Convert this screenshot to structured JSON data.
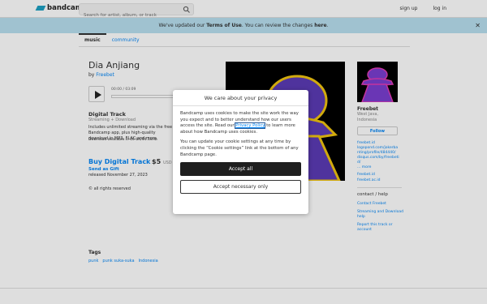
{
  "header": {
    "logo_text": "bandcamp",
    "search_placeholder": "Search for artist, album, or track",
    "signup": "sign up",
    "login": "log in"
  },
  "banner": {
    "prefix": "We've updated our ",
    "terms": "Terms of Use",
    "middle": ". You can review the changes ",
    "here": "here",
    "suffix": "."
  },
  "tabs": [
    "music",
    "community"
  ],
  "album": {
    "title": "Dia Anjiang",
    "by": "by",
    "artist": "Freebet",
    "time": "00:00 / 03:09",
    "digital_track": "Digital Track",
    "streaming": "Streaming + Download",
    "description": "Includes unlimited streaming via the free Bandcamp app, plus high-quality download in MP3, FLAC and more.",
    "format": "Download available in 16-bit/44.1kHz.",
    "buy": "Buy Digital Track",
    "price": "$5",
    "currency": "USD",
    "gift": "Send as Gift",
    "released": "released November 27, 2023",
    "rights": "all rights reserved"
  },
  "tags": {
    "title": "Tags",
    "items": [
      "punk",
      "punk suka-suka",
      "Indonesia"
    ]
  },
  "artist": {
    "name": "Freebet",
    "location_1": "West Java,",
    "location_2": "Indonesia",
    "follow": "Follow",
    "links": [
      "freebet.id",
      "logopond.com/jokerbanting/profile/484440/",
      "disqus.com/by/freebetid/"
    ],
    "more": "... more",
    "sites": [
      "freebet.id",
      "freebet.ac.id"
    ],
    "contact_title": "contact / help",
    "contact_links": [
      "Contact Freebet",
      "Streaming and Download help",
      "Report this track or account"
    ]
  },
  "modal": {
    "title": "We care about your privacy",
    "p1_before": "Bandcamp uses cookies to make the site work the way you expect and to better understand how our users access the site. Read our ",
    "privacy_policy": "Privacy Policy",
    "p1_after": " to learn more about how Bandcamp uses cookies.",
    "p2": "You can update your cookie settings at any time by clicking the “Cookie settings” link at the bottom of any Bandcamp page.",
    "accept_all": "Accept all",
    "accept_necessary": "Accept necessary only"
  },
  "colors": {
    "accent_link": "#0687f5",
    "banner_bg": "#b8dfef",
    "cover_purple": "#5b3bb5",
    "cover_gold": "#f1c40f"
  }
}
